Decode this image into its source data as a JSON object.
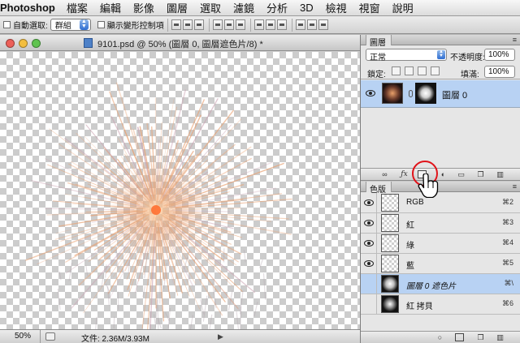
{
  "app": {
    "name": "Photoshop"
  },
  "menu": [
    "檔案",
    "編輯",
    "影像",
    "圖層",
    "選取",
    "濾鏡",
    "分析",
    "3D",
    "檢視",
    "視窗",
    "說明"
  ],
  "options": {
    "auto_select_label": "自動選取:",
    "auto_select_value": "群組",
    "show_transform_label": "顯示變形控制項"
  },
  "document": {
    "title": "9101.psd @ 50% (圖層 0, 圖層遮色片/8) *",
    "zoom": "50%",
    "file_info": "文件: 2.36M/3.93M"
  },
  "layers_panel": {
    "tab": "圖層",
    "blend_mode": "正常",
    "opacity_label": "不透明度:",
    "opacity_value": "100%",
    "lock_label": "鎖定:",
    "fill_label": "填滿:",
    "fill_value": "100%",
    "layers": [
      {
        "name": "圖層 0",
        "visible": true,
        "selected": true
      }
    ],
    "footer_icons": [
      "link-icon",
      "fx-icon",
      "add-mask-icon",
      "adjustment-icon",
      "group-icon",
      "new-layer-icon",
      "trash-icon"
    ]
  },
  "channels_panel": {
    "tab": "色版",
    "channels": [
      {
        "name": "RGB",
        "shortcut": "⌘2",
        "visible": true,
        "selected": false
      },
      {
        "name": "紅",
        "shortcut": "⌘3",
        "visible": true,
        "selected": false
      },
      {
        "name": "綠",
        "shortcut": "⌘4",
        "visible": true,
        "selected": false
      },
      {
        "name": "藍",
        "shortcut": "⌘5",
        "visible": true,
        "selected": false
      },
      {
        "name": "圖層 0 遮色片",
        "shortcut": "⌘\\",
        "visible": false,
        "selected": true
      },
      {
        "name": "紅 拷貝",
        "shortcut": "⌘6",
        "visible": false,
        "selected": false
      }
    ]
  },
  "colors": {
    "selection": "#b8d2f3",
    "highlight_circle": "#e0141a",
    "firework_warm": "#e8a070",
    "firework_core": "#ff6a2a"
  }
}
